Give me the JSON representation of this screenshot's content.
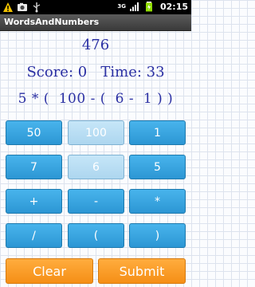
{
  "status_bar": {
    "network": "3G",
    "time": "02:15"
  },
  "app": {
    "title": "WordsAndNumbers"
  },
  "game": {
    "target": "476",
    "score_line": "Score: 0   Time: 33",
    "expression": "5 * (  100 - (  6 -  1 ) )"
  },
  "keys": {
    "row1": [
      "50",
      "100",
      "1"
    ],
    "row2": [
      "7",
      "6",
      "5"
    ],
    "row3": [
      "+",
      "-",
      "*"
    ],
    "row4": [
      "/",
      "(",
      ")"
    ]
  },
  "actions": {
    "clear": "Clear",
    "submit": "Submit"
  },
  "colors": {
    "button_blue": "#3aa6e2",
    "button_used": "#b9dcf2",
    "action_orange": "#f89b22",
    "text_blue": "#2a2fa3"
  }
}
